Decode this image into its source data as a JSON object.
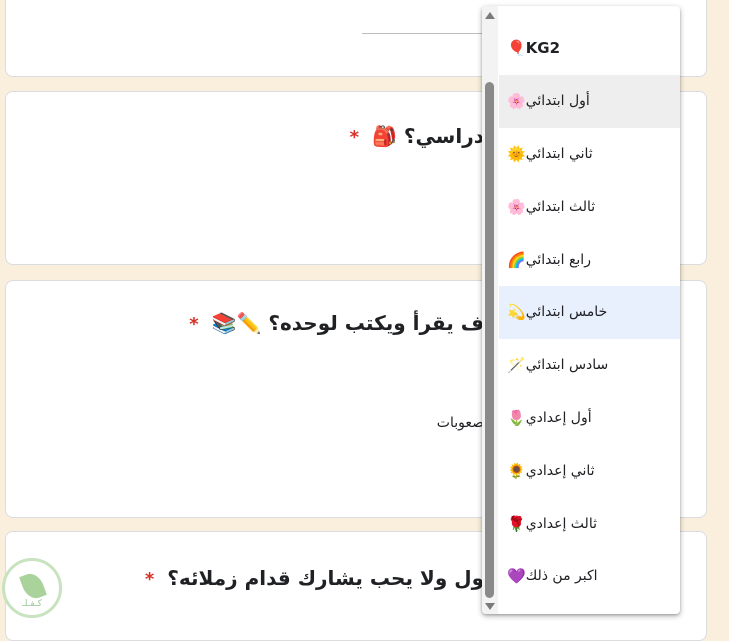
{
  "cards": {
    "q1": {
      "title": "دراسي؟ 🎒",
      "required_mark": "*"
    },
    "q2": {
      "title": "ف يقرأ ويكتب لوحده؟ ✏️📚",
      "required_mark": "*",
      "option_text": "صعوبات"
    },
    "q3": {
      "title": "ول ولا يحب يشارك قدام زملائه؟",
      "required_mark": "*"
    }
  },
  "dropdown": {
    "items": [
      {
        "label": "KG2",
        "emoji": "🎈",
        "state": "normal"
      },
      {
        "label": "أول ابتدائي",
        "emoji": "🌸",
        "state": "hovered"
      },
      {
        "label": "ثاني ابتدائي",
        "emoji": "🌞",
        "state": "normal"
      },
      {
        "label": "ثالث ابتدائي",
        "emoji": "🌸",
        "state": "normal"
      },
      {
        "label": "رابع ابتدائي",
        "emoji": "🌈",
        "state": "normal"
      },
      {
        "label": "خامس ابتدائي",
        "emoji": "💫",
        "state": "selected"
      },
      {
        "label": "سادس ابتدائي",
        "emoji": "🪄",
        "state": "normal"
      },
      {
        "label": "أول إعدادي",
        "emoji": "🌷",
        "state": "normal"
      },
      {
        "label": "ثاني إعدادي",
        "emoji": "🌻",
        "state": "normal"
      },
      {
        "label": "ثالث إعدادي",
        "emoji": "🌹",
        "state": "normal"
      },
      {
        "label": "اكبر من ذلك",
        "emoji": "💜",
        "state": "normal"
      }
    ]
  },
  "logo": {
    "text": "كـفـلـ"
  },
  "colors": {
    "page_background": "#faefdc",
    "required": "#d93025",
    "hover": "#eeeeee",
    "selected": "#e8f0fe"
  }
}
